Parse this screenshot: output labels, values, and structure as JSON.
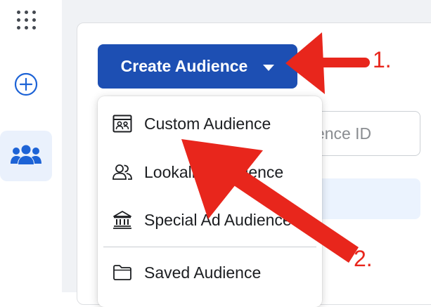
{
  "sidebar": {
    "items": [
      {
        "icon": "apps-grid-icon"
      },
      {
        "icon": "plus-circle-icon"
      },
      {
        "icon": "people-icon",
        "active": true
      }
    ],
    "active_color": "#1d63d6",
    "active_bg": "#eaf1fc"
  },
  "toolbar": {
    "create_label": "Create Audience",
    "create_bg": "#1d4fb3"
  },
  "search": {
    "placeholder_visible": "dience ID"
  },
  "dropdown": {
    "items": [
      {
        "label": "Custom Audience",
        "icon": "custom-audience-icon"
      },
      {
        "label": "Lookalike Audience",
        "icon": "lookalike-people-icon"
      },
      {
        "label": "Special Ad Audience",
        "icon": "bank-building-icon"
      },
      {
        "label": "Saved Audience",
        "icon": "folder-icon"
      }
    ]
  },
  "annotations": {
    "step1": "1.",
    "step2": "2.",
    "color": "#e8261c"
  }
}
